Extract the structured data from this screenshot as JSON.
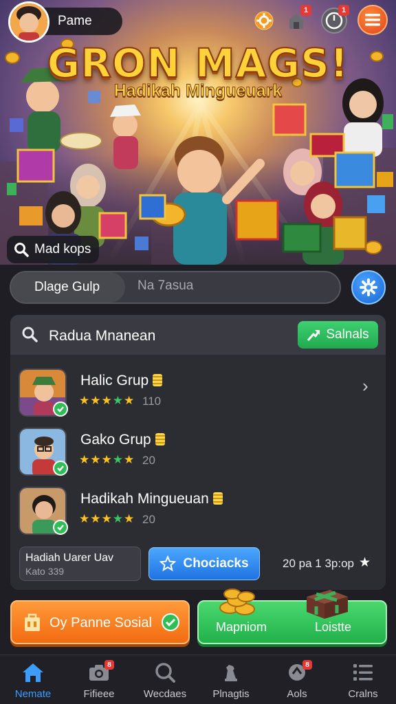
{
  "header": {
    "player_name": "Pame",
    "icons": [
      "settings-gear-icon",
      "notification-icon",
      "timer-icon",
      "menu-icon"
    ],
    "notification_badge": "1",
    "timer_badge": "1"
  },
  "hero": {
    "title": "GRON MAGS!",
    "subtitle": "Hadikah Mingueuark",
    "search_chip": "Mad kops"
  },
  "segment": {
    "left_label": "Dlage Gulp",
    "right_label": "Na 7asua"
  },
  "panel": {
    "title": "Radua Mnanean",
    "action_label": "Salnals",
    "rows": [
      {
        "name": "Halic Grup",
        "count": "110"
      },
      {
        "name": "Gako Grup",
        "count": "20"
      },
      {
        "name": "Hadikah Mingueuan",
        "count": "20"
      }
    ],
    "footer": {
      "box_title": "Hadiah Uarer Uav",
      "box_sub": "Kato 339",
      "button_label": "Chociacks",
      "right_text": "20 pa 1 3p:op"
    }
  },
  "actions": {
    "orange_label": "Oy Panne Sosial",
    "green_left": "Mapniom",
    "green_right": "Loistte"
  },
  "nav": {
    "items": [
      {
        "label": "Nemate",
        "icon": "home-icon",
        "active": true
      },
      {
        "label": "Fifieee",
        "icon": "camera-icon",
        "badge": "8"
      },
      {
        "label": "Wecdaes",
        "icon": "search-icon"
      },
      {
        "label": "Plnagtis",
        "icon": "chess-icon"
      },
      {
        "label": "Aols",
        "icon": "tag-icon",
        "badge": "8"
      },
      {
        "label": "Cralns",
        "icon": "list-icon"
      }
    ]
  },
  "colors": {
    "accent_blue": "#2d8cff",
    "accent_green": "#2fbe55",
    "accent_orange": "#f57c1f",
    "panel_bg": "#2c2c33"
  }
}
